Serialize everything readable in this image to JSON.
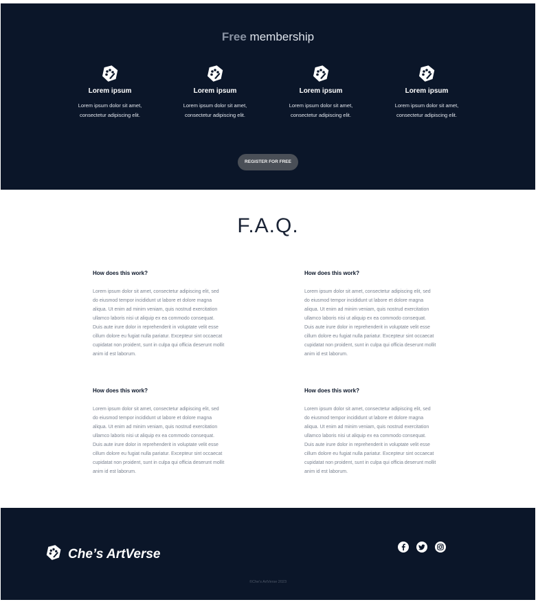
{
  "membership": {
    "title_bold": "Free",
    "title_rest": " membership",
    "features": [
      {
        "icon": "palette-icon",
        "title": "Lorem ipsum",
        "desc_line1": "Lorem ipsum dolor sit amet,",
        "desc_line2": "consectetur adipiscing elit."
      },
      {
        "icon": "palette-icon",
        "title": "Lorem ipsum",
        "desc_line1": "Lorem ipsum dolor sit amet,",
        "desc_line2": "consectetur adipiscing elit."
      },
      {
        "icon": "palette-icon",
        "title": "Lorem ipsum",
        "desc_line1": "Lorem ipsum dolor sit amet,",
        "desc_line2": "consectetur adipiscing elit."
      },
      {
        "icon": "palette-icon",
        "title": "Lorem ipsum",
        "desc_line1": "Lorem ipsum dolor sit amet,",
        "desc_line2": "consectetur adipiscing elit."
      }
    ],
    "register_label": "REGISTER FOR FREE"
  },
  "faq": {
    "title": "F.A.Q.",
    "items": [
      {
        "question": "How does this work?",
        "answer": "Lorem ipsum dolor sit amet, consectetur adipiscing elit, sed do eiusmod tempor incididunt ut labore et dolore magna aliqua. Ut enim ad minim veniam, quis nostrud exercitation ullamco laboris nisi ut aliquip ex ea commodo consequat. Duis aute irure dolor in reprehenderit in voluptate velit esse cillum dolore eu fugiat nulla pariatur. Excepteur sint occaecat cupidatat non proident, sunt in culpa qui officia deserunt mollit anim id est laborum."
      },
      {
        "question": "How does this work?",
        "answer": "Lorem ipsum dolor sit amet, consectetur adipiscing elit, sed do eiusmod tempor incididunt ut labore et dolore magna aliqua. Ut enim ad minim veniam, quis nostrud exercitation ullamco laboris nisi ut aliquip ex ea commodo consequat. Duis aute irure dolor in reprehenderit in voluptate velit esse cillum dolore eu fugiat nulla pariatur. Excepteur sint occaecat cupidatat non proident, sunt in culpa qui officia deserunt mollit anim id est laborum."
      },
      {
        "question": "How does this work?",
        "answer": "Lorem ipsum dolor sit amet, consectetur adipiscing elit, sed do eiusmod tempor incididunt ut labore et dolore magna aliqua. Ut enim ad minim veniam, quis nostrud exercitation ullamco laboris nisi ut aliquip ex ea commodo consequat. Duis aute irure dolor in reprehenderit in voluptate velit esse cillum dolore eu fugiat nulla pariatur. Excepteur sint occaecat cupidatat non proident, sunt in culpa qui officia deserunt mollit anim id est laborum."
      },
      {
        "question": "How does this work?",
        "answer": "Lorem ipsum dolor sit amet, consectetur adipiscing elit, sed do eiusmod tempor incididunt ut labore et dolore magna aliqua. Ut enim ad minim veniam, quis nostrud exercitation ullamco laboris nisi ut aliquip ex ea commodo consequat. Duis aute irure dolor in reprehenderit in voluptate velit esse cillum dolore eu fugiat nulla pariatur. Excepteur sint occaecat cupidatat non proident, sunt in culpa qui officia deserunt mollit anim id est laborum."
      }
    ]
  },
  "footer": {
    "brand_icon": "palette-icon",
    "brand": "Che’s ArtVerse",
    "social": [
      "facebook-icon",
      "twitter-icon",
      "instagram-icon"
    ],
    "copyright": "©Che’s ArtVerse 2023"
  },
  "colors": {
    "dark_navy": "#0b1629",
    "button_gray": "#4a4f57",
    "muted_text": "#7a8290"
  }
}
